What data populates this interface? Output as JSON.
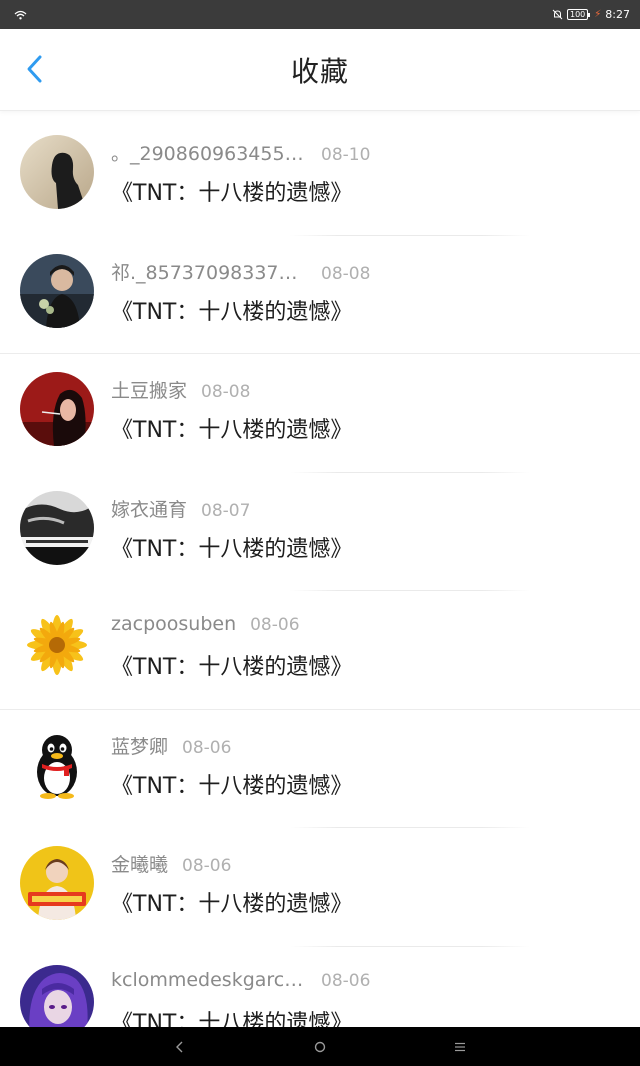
{
  "status_bar": {
    "time": "8:27",
    "battery": "100",
    "icons": [
      "wifi-icon",
      "bell-off-icon",
      "battery-icon",
      "charging-icon"
    ]
  },
  "header": {
    "title": "收藏",
    "back_icon": "chevron-left-icon"
  },
  "colors": {
    "accent": "#2f9bf0",
    "status_bar_bg": "#3b3b3b",
    "nav_bar_bg": "#000000",
    "title_text": "#1e1e1e",
    "name_text": "#8a8a8a",
    "date_text": "#b0b0b0"
  },
  "favorites": [
    {
      "name": "。_2908609634558..",
      "date": "08-10",
      "title": "《TNT：十八楼的遗憾》",
      "avatar": "girl-silhouette-avatar"
    },
    {
      "name": "祁._857370983372...",
      "date": "08-08",
      "title": "《TNT：十八楼的遗憾》",
      "avatar": "boy-with-flowers-avatar"
    },
    {
      "name": "土豆搬家",
      "date": "08-08",
      "title": "《TNT：十八楼的遗憾》",
      "avatar": "red-smoking-girl-avatar"
    },
    {
      "name": "嫁衣通育",
      "date": "08-07",
      "title": "《TNT：十八楼的遗憾》",
      "avatar": "black-white-photo-avatar"
    },
    {
      "name": "zacpoosuben",
      "date": "08-06",
      "title": "《TNT：十八楼的遗憾》",
      "avatar": "sunflower-avatar"
    },
    {
      "name": "蓝梦卿",
      "date": "08-06",
      "title": "《TNT：十八楼的遗憾》",
      "avatar": "qq-penguin-avatar"
    },
    {
      "name": "金曦曦",
      "date": "08-06",
      "title": "《TNT：十八楼的遗憾》",
      "avatar": "boy-with-banner-avatar"
    },
    {
      "name": "kclommedeskgarcx...",
      "date": "08-06",
      "title": "《TNT：十八楼的遗憾》",
      "avatar": "purple-anime-avatar"
    }
  ],
  "nav_bar": {
    "icons": [
      "back-nav-icon",
      "home-nav-icon",
      "menu-nav-icon"
    ]
  }
}
